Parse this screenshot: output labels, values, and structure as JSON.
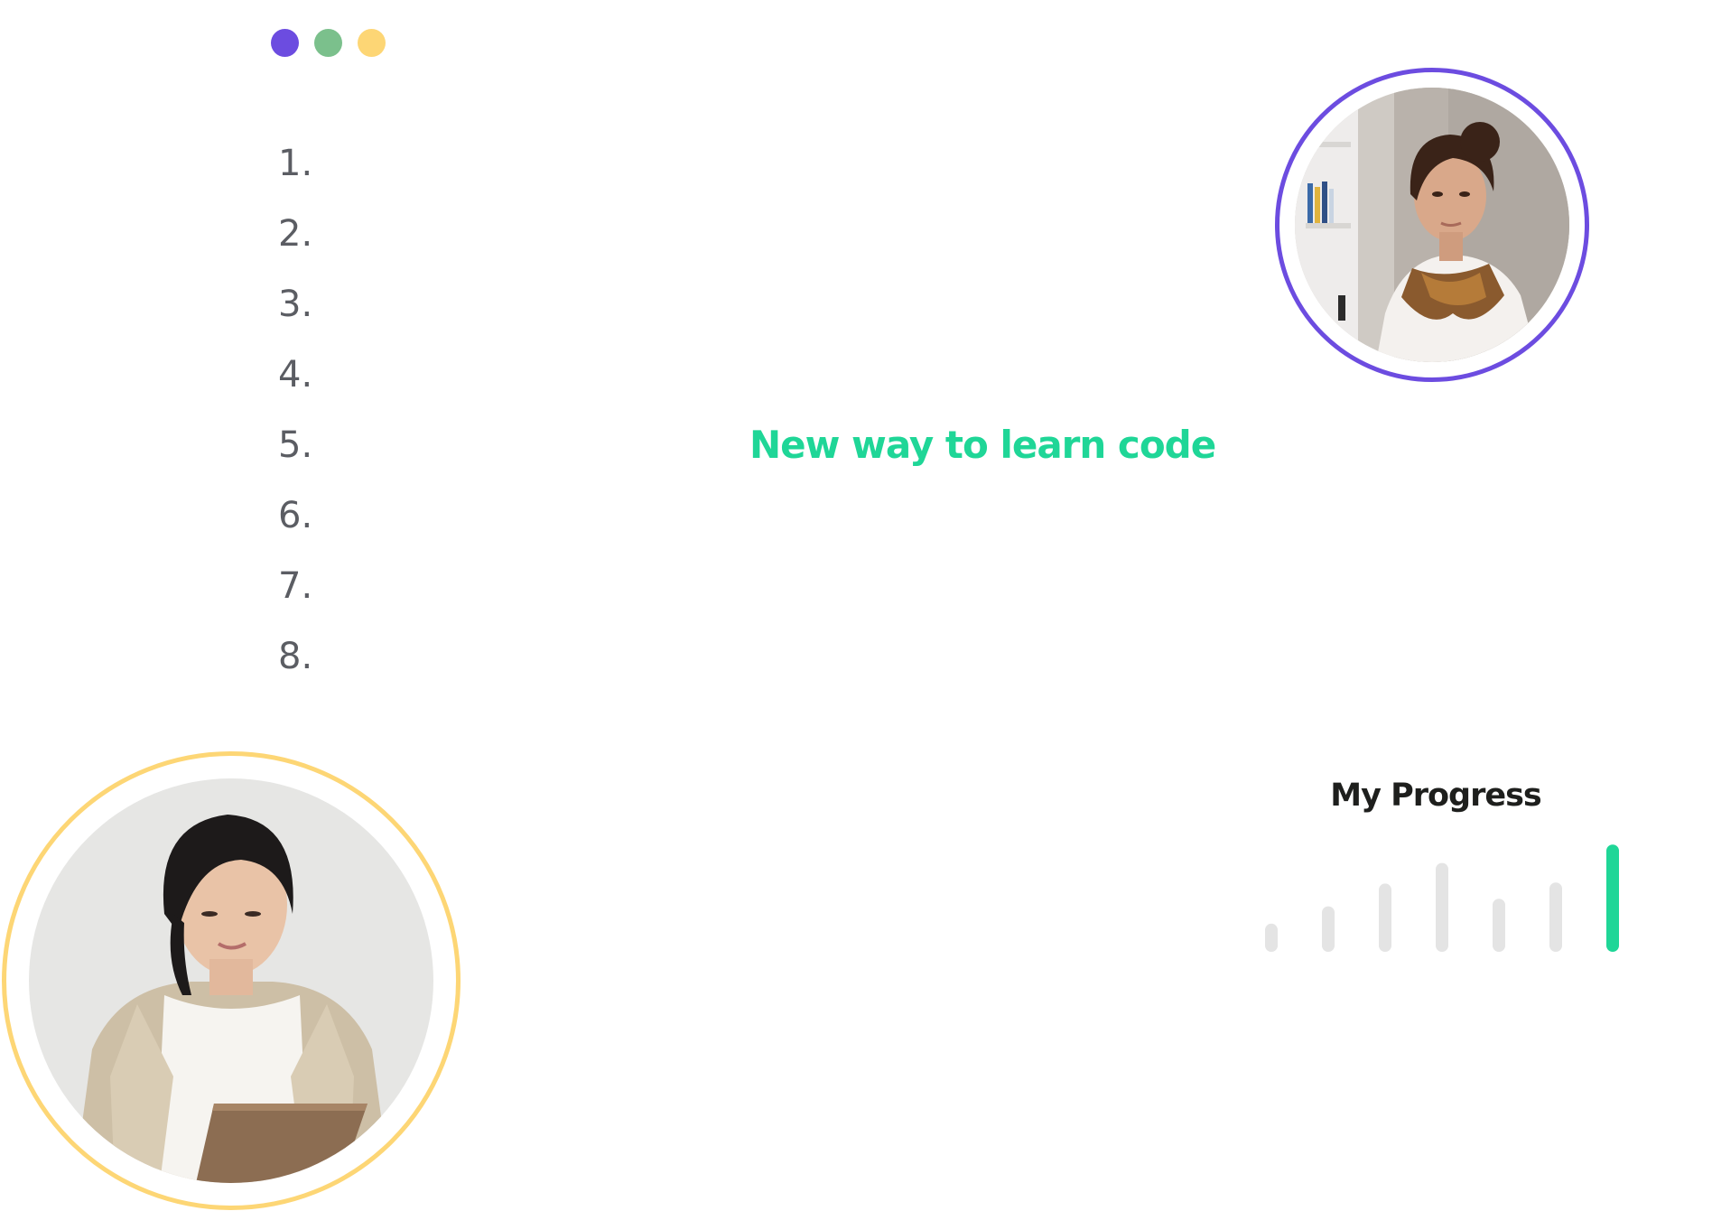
{
  "window": {
    "dots": [
      {
        "name": "dot-purple",
        "color": "#6c4ce0"
      },
      {
        "name": "dot-green",
        "color": "#7bc08c"
      },
      {
        "name": "dot-yellow",
        "color": "#fdd675"
      }
    ]
  },
  "editor": {
    "line_numbers": [
      "1.",
      "2.",
      "3.",
      "4.",
      "5.",
      "6.",
      "7.",
      "8."
    ]
  },
  "hero": {
    "headline": "New way to learn code",
    "headline_color": "#1fd697"
  },
  "avatars": {
    "top_ring_color": "#6c4ce0",
    "bottom_ring_color": "#fdd675"
  },
  "progress": {
    "title": "My Progress",
    "levels": [
      0.26,
      0.42,
      0.63,
      0.82,
      0.49,
      0.64,
      0.99
    ],
    "active_index": 6,
    "active_color": "#1fd697",
    "inactive_color": "#e4e4e4"
  }
}
